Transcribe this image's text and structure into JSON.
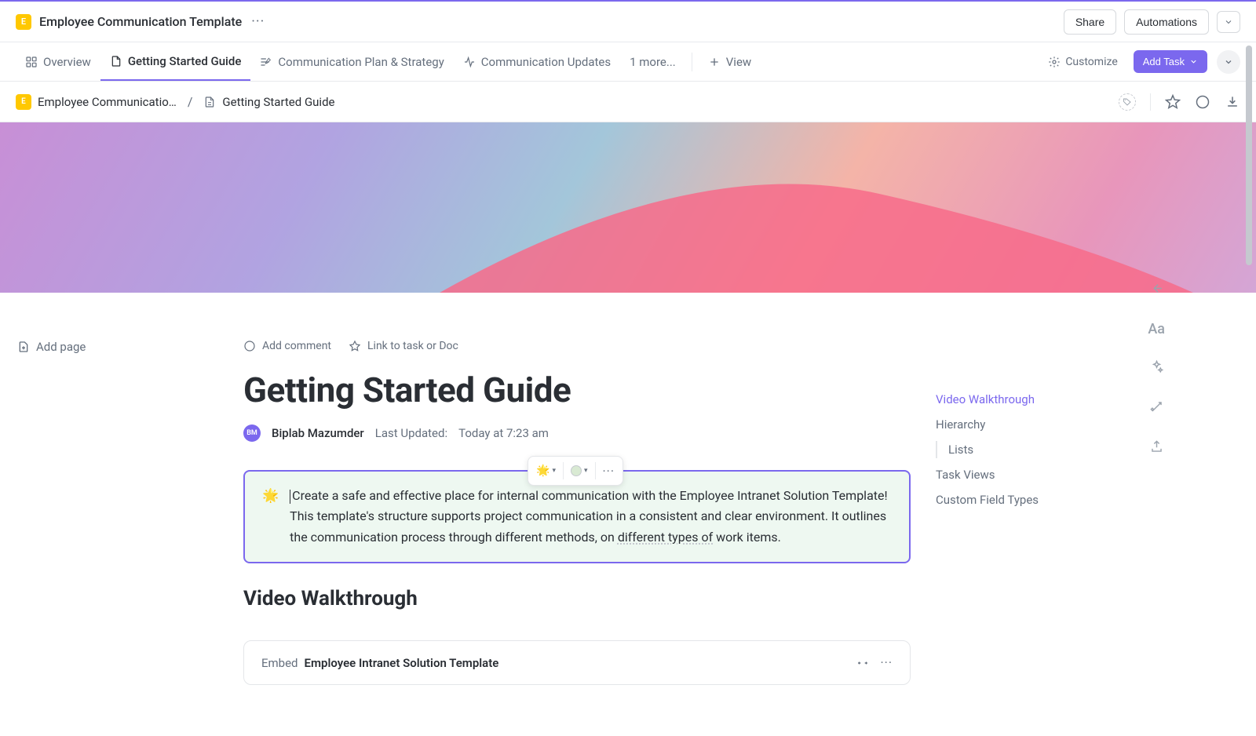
{
  "header": {
    "workspace_letter": "E",
    "workspace_title": "Employee Communication Template",
    "share_label": "Share",
    "automations_label": "Automations"
  },
  "tabs": {
    "overview": "Overview",
    "getting_started": "Getting Started Guide",
    "comm_plan": "Communication Plan & Strategy",
    "comm_updates": "Communication Updates",
    "more": "1 more...",
    "view": "View",
    "customize": "Customize",
    "add_task": "Add Task"
  },
  "breadcrumbs": {
    "parent": "Employee Communicatio…",
    "current": "Getting Started Guide"
  },
  "sidebar": {
    "add_page": "Add page"
  },
  "doc": {
    "actions": {
      "add_comment": "Add comment",
      "link_task": "Link to task or Doc"
    },
    "title": "Getting Started Guide",
    "author_initials": "BM",
    "author_name": "Biplab Mazumder",
    "last_updated_label": "Last Updated:",
    "last_updated_value": "Today at 7:23 am",
    "callout_emoji": "🌟",
    "callout_text_1": "Create a safe and effective place for internal communication with the Employee Intranet Solution Template! This template's structure supports project communication in a consistent and clear environment. It outlines the communication process through different methods, on ",
    "callout_underlined": "different types of",
    "callout_text_2": " work items.",
    "section_heading": "Video Walkthrough",
    "embed_label": "Embed",
    "embed_title": "Employee Intranet Solution Template"
  },
  "outline": {
    "items": {
      "video": "Video Walkthrough",
      "hierarchy": "Hierarchy",
      "lists": "Lists",
      "task_views": "Task Views",
      "custom_fields": "Custom Field Types"
    }
  },
  "floating": {
    "emoji": "🌟"
  }
}
